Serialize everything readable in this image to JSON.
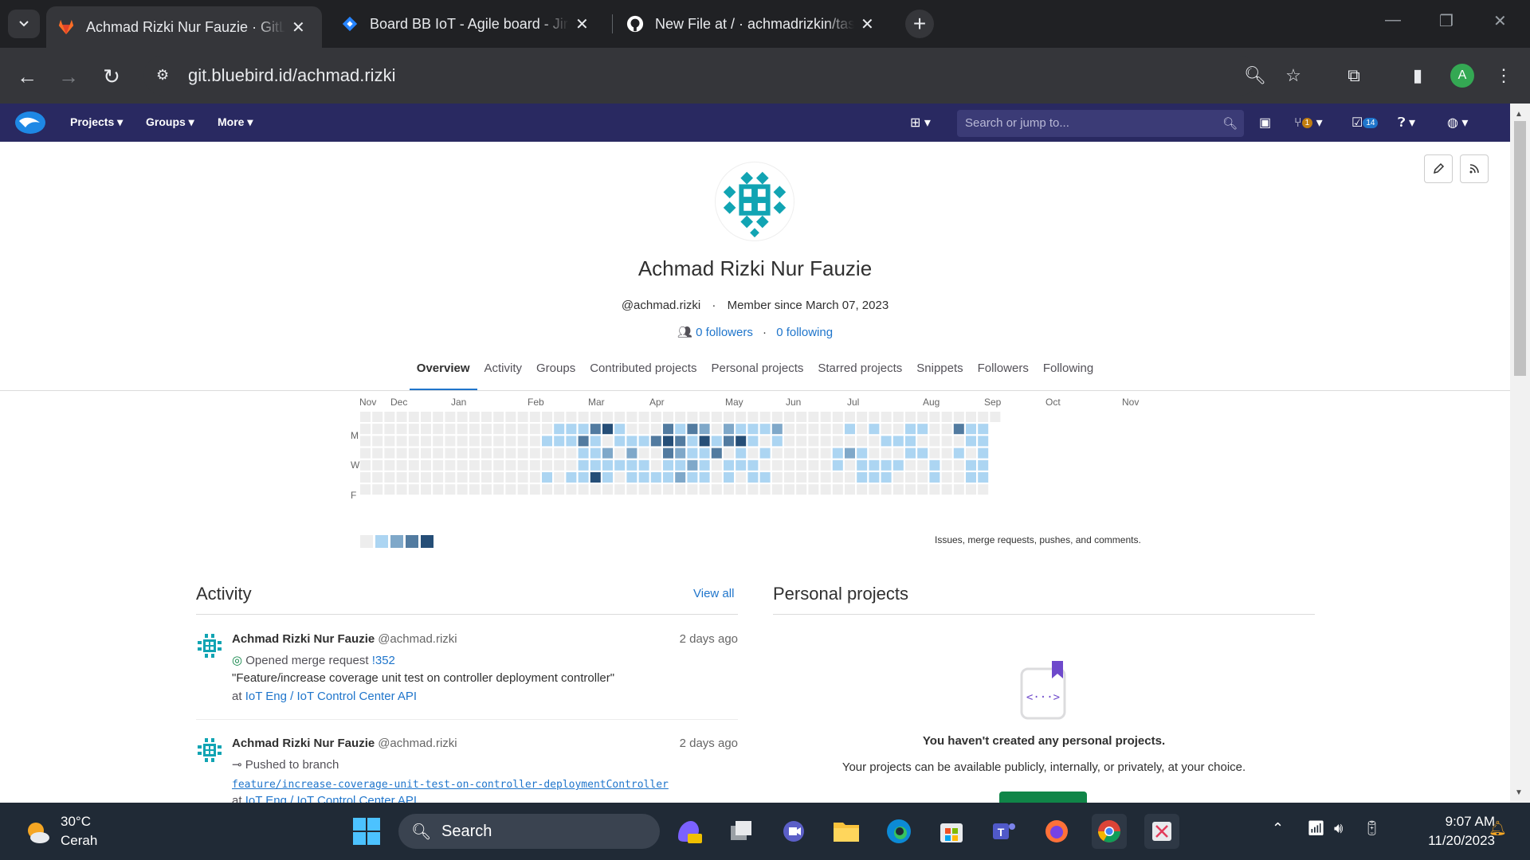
{
  "browser": {
    "tabs": [
      {
        "title": "Achmad Rizki Nur Fauzie · GitLab",
        "active": true
      },
      {
        "title": "Board BB IoT - Agile board - Jira",
        "active": false
      },
      {
        "title": "New File at / · achmadrizkin/task",
        "active": false
      }
    ],
    "url": "git.bluebird.id/achmad.rizki",
    "profile_initial": "A"
  },
  "gitlab_header": {
    "nav": [
      "Projects",
      "Groups",
      "More"
    ],
    "search_placeholder": "Search or jump to...",
    "mr_count": "1",
    "todo_count": "14"
  },
  "profile": {
    "name": "Achmad Rizki Nur Fauzie",
    "username": "@achmad.rizki",
    "member_since": "Member since March 07, 2023",
    "followers": "0 followers",
    "following": "0 following",
    "tabs": [
      "Overview",
      "Activity",
      "Groups",
      "Contributed projects",
      "Personal projects",
      "Starred projects",
      "Snippets",
      "Followers",
      "Following"
    ],
    "active_tab": "Overview"
  },
  "calendar": {
    "months": [
      "Nov",
      "Dec",
      "Jan",
      "Feb",
      "Mar",
      "Apr",
      "May",
      "Jun",
      "Jul",
      "Aug",
      "Sep",
      "Oct",
      "Nov"
    ],
    "days": [
      "M",
      "W",
      "F"
    ],
    "legend_text": "Issues, merge requests, pushes, and comments.",
    "colors": [
      "#ededed",
      "#acd5f2",
      "#7fa8c9",
      "#527ba0",
      "#254e77"
    ]
  },
  "activity": {
    "title": "Activity",
    "view_all": "View all",
    "events": [
      {
        "author": "Achmad Rizki Nur Fauzie",
        "username": "@achmad.rizki",
        "time": "2 days ago",
        "action": "Opened merge request",
        "ref": "!352",
        "detail": "\"Feature/increase coverage unit test on controller deployment controller\"",
        "at": "at",
        "project": "IoT Eng / IoT Control Center API"
      },
      {
        "author": "Achmad Rizki Nur Fauzie",
        "username": "@achmad.rizki",
        "time": "2 days ago",
        "action": "Pushed to branch",
        "branch": "feature/increase-coverage-unit-test-on-controller-deploymentController",
        "at": "at",
        "project": "IoT Eng / IoT Control Center API"
      }
    ]
  },
  "personal_projects": {
    "title": "Personal projects",
    "empty_title": "You haven't created any personal projects.",
    "empty_desc": "Your projects can be available publicly, internally, or privately, at your choice."
  },
  "taskbar": {
    "temperature": "30°C",
    "weather": "Cerah",
    "search": "Search",
    "time": "9:07 AM",
    "date": "11/20/2023"
  }
}
